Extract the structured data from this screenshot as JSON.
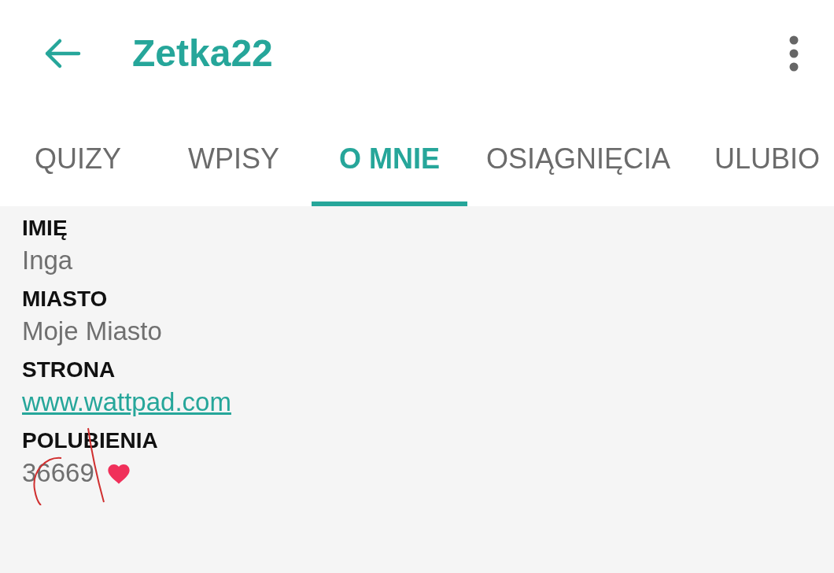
{
  "app_bar": {
    "title": "Zetka22"
  },
  "tabs": [
    {
      "label": "QUIZY",
      "selected": false
    },
    {
      "label": "WPISY",
      "selected": false
    },
    {
      "label": "O MNIE",
      "selected": true
    },
    {
      "label": "OSIĄGNIĘCIA",
      "selected": false
    },
    {
      "label": "ULUBIO",
      "selected": false
    }
  ],
  "fields": [
    {
      "kind": "text",
      "label": "IMIĘ",
      "value": "Inga"
    },
    {
      "kind": "text",
      "label": "MIASTO",
      "value": "Moje Miasto"
    },
    {
      "kind": "link",
      "label": "STRONA",
      "value": "www.wattpad.com"
    },
    {
      "kind": "likes",
      "label": "POLUBIENIA",
      "value": "36669"
    }
  ]
}
